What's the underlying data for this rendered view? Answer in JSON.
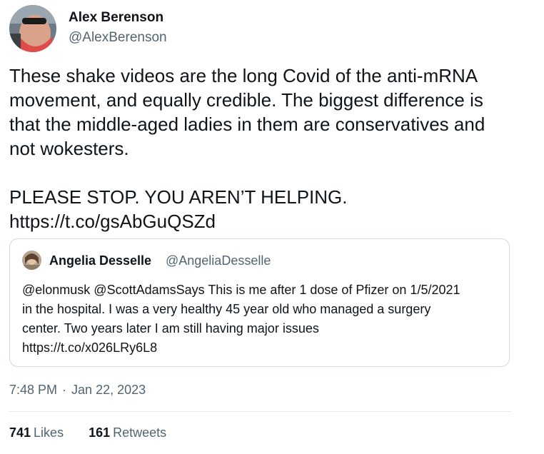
{
  "author": {
    "name": "Alex Berenson",
    "handle": "@AlexBerenson"
  },
  "tweet": {
    "line1": "These shake videos are the long Covid of the anti-mRNA",
    "line2": "movement, and equally credible. The biggest difference is",
    "line3": "that the middle-aged ladies in them are conservatives and",
    "line4": "not wokesters.",
    "line5": "PLEASE STOP. YOU AREN’T HELPING.",
    "link": "https://t.co/gsAbGuQSZd"
  },
  "quote": {
    "name": "Angelia Desselle",
    "handle": "@AngeliaDesselle",
    "line1": "@elonmusk @ScottAdamsSays This is me after 1 dose of Pfizer on 1/5/2021",
    "line2": "in the hospital. I was a very healthy 45 year old who managed a surgery",
    "line3": "center.  Two years later I am still having major issues",
    "link": "https://t.co/x026LRy6L8"
  },
  "meta": {
    "time": "7:48 PM",
    "separator": "·",
    "date": "Jan 22, 2023"
  },
  "stats": {
    "likes_count": "741",
    "likes_label": "Likes",
    "retweets_count": "161",
    "retweets_label": "Retweets"
  }
}
